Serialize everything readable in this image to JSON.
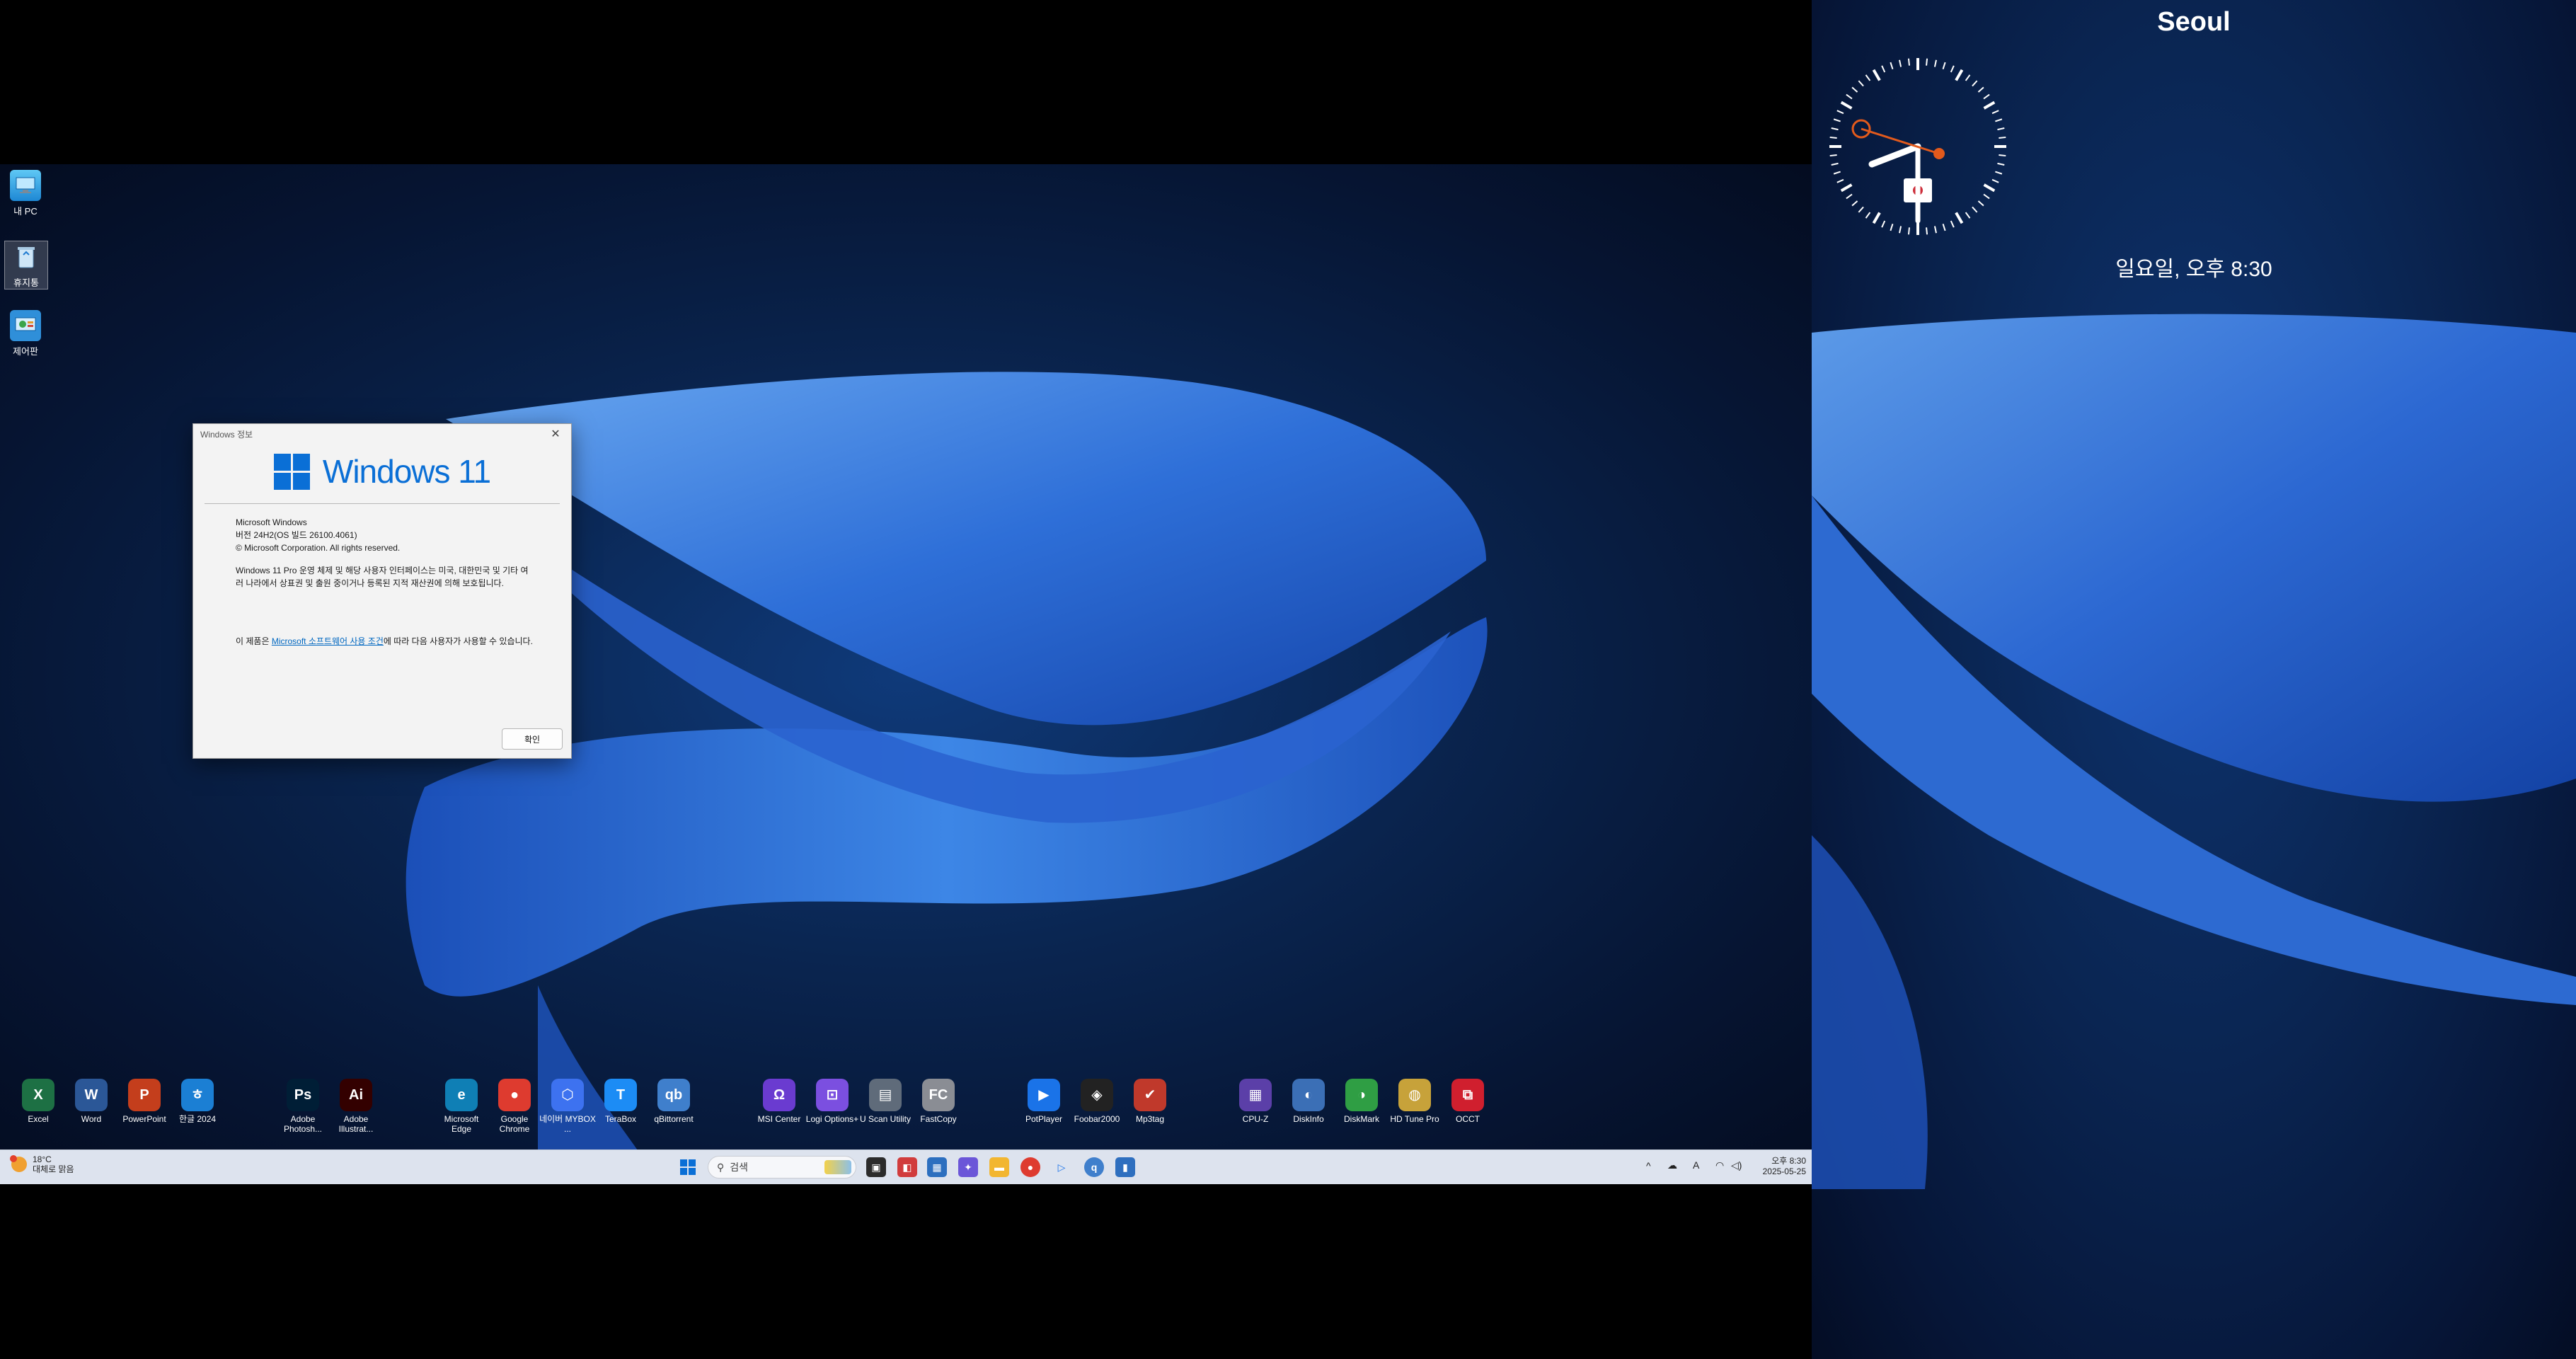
{
  "desktop_icons": [
    {
      "label": "내 PC",
      "icon": "pc-icon"
    },
    {
      "label": "휴지통",
      "icon": "recycle-bin-icon"
    },
    {
      "label": "제어판",
      "icon": "control-panel-icon"
    }
  ],
  "dialog": {
    "title": "Windows 정보",
    "product": "Windows 11",
    "line1": "Microsoft Windows",
    "line2": "버전 24H2(OS 빌드 26100.4061)",
    "line3": "© Microsoft Corporation. All rights reserved.",
    "para": "Windows 11 Pro 운영 체제 및 해당 사용자 인터페이스는 미국, 대한민국 및 기타 여러 나라에서 상표권 및 출원 중이거나 등록된 지적 재산권에 의해 보호됩니다.",
    "license_prefix": "이 제품은 ",
    "license_link": "Microsoft 소프트웨어 사용 조건",
    "license_suffix": "에 따라 다음 사용자가 사용할 수 있습니다.",
    "ok_label": "확인"
  },
  "apps": [
    {
      "label": "Excel",
      "icon": "excel-icon",
      "text": "X",
      "color": "#1d7044"
    },
    {
      "label": "Word",
      "icon": "word-icon",
      "text": "W",
      "color": "#2b5797"
    },
    {
      "label": "PowerPoint",
      "icon": "powerpoint-icon",
      "text": "P",
      "color": "#c43e1c"
    },
    {
      "label": "한글 2024",
      "icon": "hangul-icon",
      "text": "ㅎ",
      "color": "#1b7fd4"
    },
    {
      "label": "Adobe Photosh...",
      "icon": "photoshop-icon",
      "text": "Ps",
      "color": "#001e36"
    },
    {
      "label": "Adobe Illustrat...",
      "icon": "illustrator-icon",
      "text": "Ai",
      "color": "#330000"
    },
    {
      "label": "Microsoft Edge",
      "icon": "edge-icon",
      "text": "e",
      "color": "#0f7fb5"
    },
    {
      "label": "Google Chrome",
      "icon": "chrome-icon",
      "text": "●",
      "color": "#de3b2f"
    },
    {
      "label": "네이버 MYBOX ...",
      "icon": "mybox-icon",
      "text": "⬡",
      "color": "#3d72f0"
    },
    {
      "label": "TeraBox",
      "icon": "terabox-icon",
      "text": "T",
      "color": "#1c8cf5"
    },
    {
      "label": "qBittorrent",
      "icon": "qbittorrent-icon",
      "text": "qb",
      "color": "#3f7fcc"
    },
    {
      "label": "MSI Center",
      "icon": "msi-center-icon",
      "text": "Ω",
      "color": "#6a3bd0"
    },
    {
      "label": "Logi Options+",
      "icon": "logi-icon",
      "text": "⊡",
      "color": "#7b4fe0"
    },
    {
      "label": "U Scan Utility",
      "icon": "uscan-icon",
      "text": "▤",
      "color": "#5f6b7a"
    },
    {
      "label": "FastCopy",
      "icon": "fastcopy-icon",
      "text": "FC",
      "color": "#8a8d94"
    },
    {
      "label": "PotPlayer",
      "icon": "potplayer-icon",
      "text": "▶",
      "color": "#1a73e8"
    },
    {
      "label": "Foobar2000",
      "icon": "foobar-icon",
      "text": "◈",
      "color": "#222222"
    },
    {
      "label": "Mp3tag",
      "icon": "mp3tag-icon",
      "text": "✔",
      "color": "#c0392b"
    },
    {
      "label": "CPU-Z",
      "icon": "cpuz-icon",
      "text": "▦",
      "color": "#5b3fa8"
    },
    {
      "label": "DiskInfo",
      "icon": "diskinfo-icon",
      "text": "◐",
      "color": "#3b6fb6"
    },
    {
      "label": "DiskMark",
      "icon": "diskmark-icon",
      "text": "◑",
      "color": "#2f9e44"
    },
    {
      "label": "HD Tune Pro",
      "icon": "hdtune-icon",
      "text": "◍",
      "color": "#c7a23a"
    },
    {
      "label": "OCCT",
      "icon": "occt-icon",
      "text": "⧉",
      "color": "#d01f2e"
    }
  ],
  "taskbar": {
    "weather_temp": "18°C",
    "weather_desc": "대체로 맑음",
    "search_placeholder": "검색",
    "time": "오후 8:30",
    "date": "2025-05-25",
    "ime": "A"
  },
  "widget": {
    "city": "Seoul",
    "date_time": "일요일, 오후 8:30"
  }
}
